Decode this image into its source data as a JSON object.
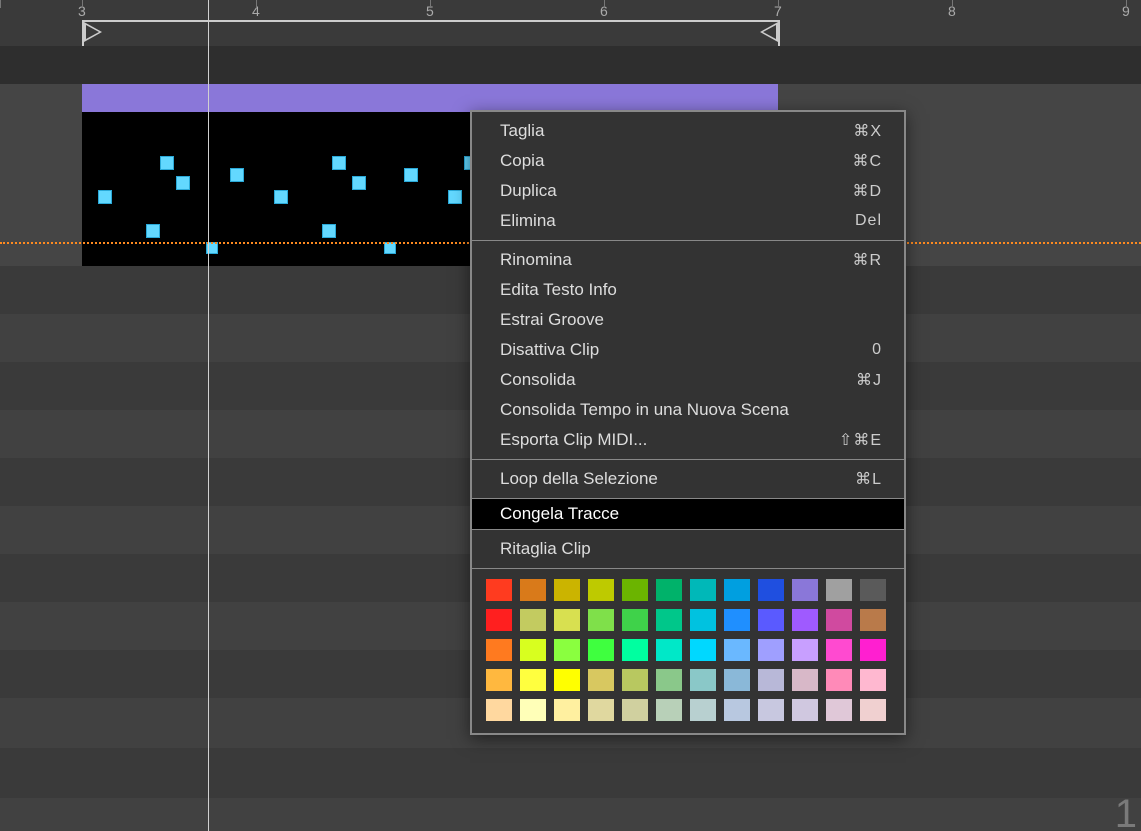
{
  "ruler": {
    "bars": [
      "3",
      "4",
      "5",
      "6",
      "7",
      "8",
      "9"
    ]
  },
  "corner_number": "1",
  "menu": {
    "g1": [
      {
        "label": "Taglia",
        "shortcut": "⌘X"
      },
      {
        "label": "Copia",
        "shortcut": "⌘C"
      },
      {
        "label": "Duplica",
        "shortcut": "⌘D"
      },
      {
        "label": "Elimina",
        "shortcut": "Del"
      }
    ],
    "g2": [
      {
        "label": "Rinomina",
        "shortcut": "⌘R"
      },
      {
        "label": "Edita Testo Info",
        "shortcut": ""
      },
      {
        "label": "Estrai Groove",
        "shortcut": ""
      },
      {
        "label": "Disattiva Clip",
        "shortcut": "0"
      },
      {
        "label": "Consolida",
        "shortcut": "⌘J"
      },
      {
        "label": "Consolida Tempo in una Nuova Scena",
        "shortcut": ""
      },
      {
        "label": "Esporta Clip MIDI...",
        "shortcut": "⇧⌘E"
      }
    ],
    "g3": [
      {
        "label": "Loop della Selezione",
        "shortcut": "⌘L"
      }
    ],
    "g4": [
      {
        "label": "Congela Tracce",
        "shortcut": ""
      }
    ],
    "g5": [
      {
        "label": "Ritaglia Clip",
        "shortcut": ""
      }
    ]
  },
  "colors": [
    [
      "#ff3b1f",
      "#d97a1a",
      "#cbb400",
      "#beca00",
      "#6bb400",
      "#00b26a",
      "#00b8b8",
      "#009fe0",
      "#1f4fe0",
      "#8a77d9",
      "#a0a0a0",
      "#5a5a5a"
    ],
    [
      "#ff1f1f",
      "#c3cb60",
      "#d8e050",
      "#7fe04a",
      "#3fd24a",
      "#00c78a",
      "#00c2e0",
      "#1f8fff",
      "#5a5aff",
      "#9f5aff",
      "#d04a9f",
      "#b97a4a"
    ],
    [
      "#ff7a1f",
      "#d8ff1f",
      "#8aff3f",
      "#3fff3f",
      "#00ffa0",
      "#00e8c8",
      "#00d8ff",
      "#6ab8ff",
      "#9f9fff",
      "#c89fff",
      "#ff4ad0",
      "#ff1fd0"
    ],
    [
      "#ffb83f",
      "#ffff3f",
      "#ffff00",
      "#d8c860",
      "#b8c860",
      "#8ac88a",
      "#8ac8c8",
      "#8ab8d8",
      "#b8b8d8",
      "#d8b8c8",
      "#ff8ab8",
      "#ffb8d0"
    ],
    [
      "#ffd89f",
      "#ffffb8",
      "#fff0a0",
      "#e0d89f",
      "#d0d09f",
      "#b8d0b8",
      "#b8d0d0",
      "#b8c8e0",
      "#c8c8e0",
      "#d0c8e0",
      "#e0c8d8",
      "#f0d0d0"
    ]
  ]
}
